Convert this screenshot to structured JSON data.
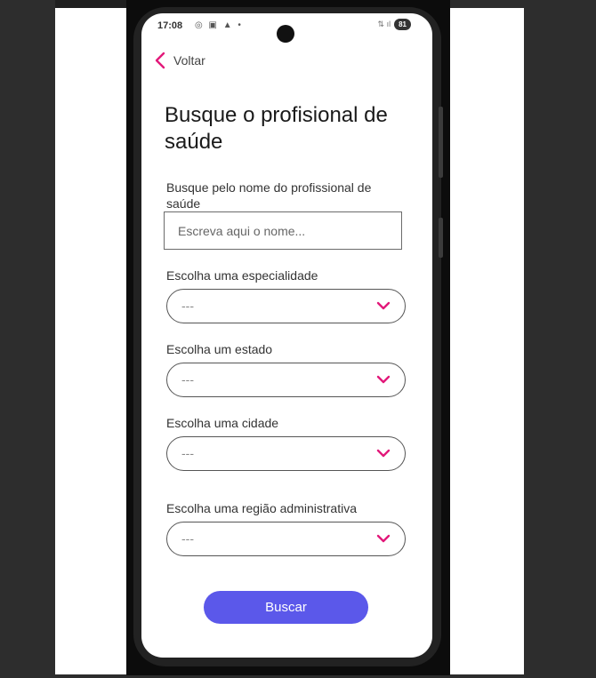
{
  "status_bar": {
    "time": "17:08",
    "left_icons": "◎ ▣ ▲ •",
    "signal": "⇅ ıl",
    "battery": "81"
  },
  "nav": {
    "back_label": "Voltar",
    "accent_color": "#e2197a"
  },
  "page": {
    "title": "Busque o profisional de saúde"
  },
  "form": {
    "name_label": "Busque pelo nome do profissional de saúde",
    "name_placeholder": "Escreva aqui o nome...",
    "name_value": "",
    "specialty_label": "Escolha uma especialidade",
    "specialty_value": "---",
    "state_label": "Escolha um estado",
    "state_value": "---",
    "city_label": "Escolha uma cidade",
    "city_value": "---",
    "region_label": "Escolha uma região administrativa",
    "region_value": "---",
    "submit_label": "Buscar",
    "button_color": "#5b58ea"
  },
  "icons": {
    "back": "chevron-left-icon",
    "dropdown": "chevron-down-icon"
  }
}
